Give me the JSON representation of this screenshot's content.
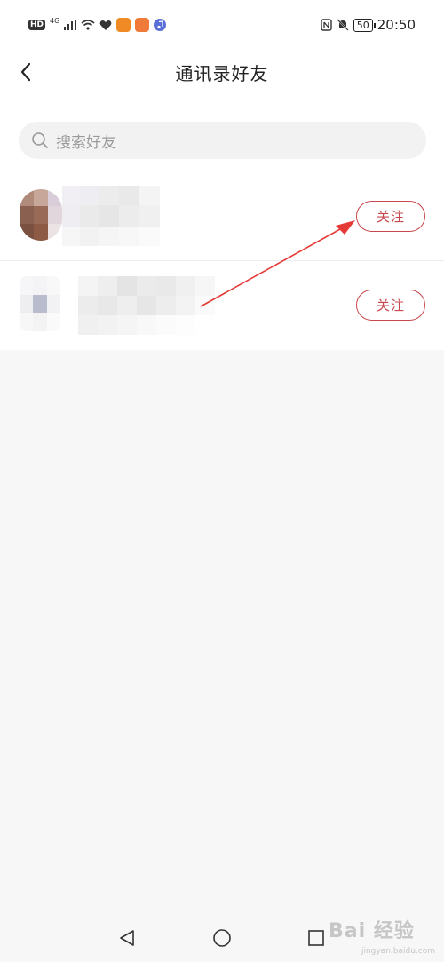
{
  "status_bar": {
    "hd": "HD",
    "network": "4G",
    "battery": "50",
    "time": "20:50"
  },
  "header": {
    "title": "通讯录好友"
  },
  "search": {
    "placeholder": "搜索好友"
  },
  "contacts": [
    {
      "follow_label": "关注"
    },
    {
      "follow_label": "关注"
    }
  ],
  "watermark": {
    "main": "Bai 经验",
    "sub": "jingyan.baidu.com"
  },
  "colors": {
    "accent": "#c8474c",
    "annotation_arrow": "#e53935",
    "background": "#f7f7f7"
  },
  "icons": {
    "back": "chevron-left-icon",
    "search": "search-icon",
    "nav_back": "triangle-back-icon",
    "nav_home": "circle-home-icon",
    "nav_recent": "square-recent-icon"
  }
}
